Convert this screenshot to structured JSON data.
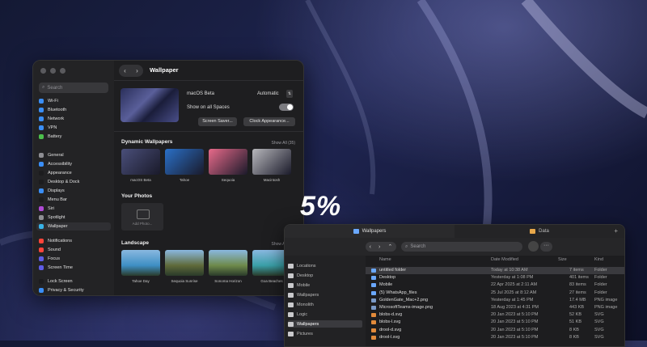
{
  "settings": {
    "search_placeholder": "Search",
    "window_title": "Wallpaper",
    "sidebar": [
      {
        "label": "Wi-Fi",
        "color": "#3a8ef6"
      },
      {
        "label": "Bluetooth",
        "color": "#3a8ef6"
      },
      {
        "label": "Network",
        "color": "#3a8ef6"
      },
      {
        "label": "VPN",
        "color": "#3a8ef6"
      },
      {
        "label": "Battery",
        "color": "#4cc04c"
      },
      {
        "label": "General",
        "color": "#8e8e93"
      },
      {
        "label": "Accessibility",
        "color": "#3a8ef6"
      },
      {
        "label": "Appearance",
        "color": "#1c1c1e"
      },
      {
        "label": "Desktop & Dock",
        "color": "#1c1c1e"
      },
      {
        "label": "Displays",
        "color": "#3a8ef6"
      },
      {
        "label": "Menu Bar",
        "color": "#1c1c1e"
      },
      {
        "label": "Siri",
        "color": "#b04ad6"
      },
      {
        "label": "Spotlight",
        "color": "#8e8e93"
      },
      {
        "label": "Wallpaper",
        "color": "#39b3e8"
      },
      {
        "label": "Notifications",
        "color": "#ff453a"
      },
      {
        "label": "Sound",
        "color": "#ff453a"
      },
      {
        "label": "Focus",
        "color": "#5e5ce6"
      },
      {
        "label": "Screen Time",
        "color": "#5e5ce6"
      },
      {
        "label": "Lock Screen",
        "color": "#1c1c1e"
      },
      {
        "label": "Privacy & Security",
        "color": "#3a8ef6"
      }
    ],
    "current_wallpaper": "macOS Beta",
    "mode": "Automatic",
    "show_all_spaces": "Show on all Spaces",
    "screen_saver_button": "Screen Saver...",
    "clock_button": "Clock Appearance...",
    "dynamic_title": "Dynamic Wallpapers",
    "dynamic_show_all": "Show All (35)",
    "dynamic": [
      {
        "label": "macOS Beta",
        "color": "#4a4f7a"
      },
      {
        "label": "Tahoe",
        "color": "#2a70c8"
      },
      {
        "label": "Sequoia",
        "color": "#e86a8a"
      },
      {
        "label": "Macintosh",
        "color": "#b8b8bc"
      }
    ],
    "photos_title": "Your Photos",
    "add_photo": "Add Photo...",
    "landscape_title": "Landscape",
    "landscape_show_all": "Show All (79)",
    "landscape": [
      {
        "label": "Tahoe Day",
        "color": "#3e8fc4"
      },
      {
        "label": "Sequoia Sunrise",
        "color": "#5f6a3a"
      },
      {
        "label": "Sonoma Horizon",
        "color": "#6e8a4a"
      },
      {
        "label": "Goa Beaches",
        "color": "#3aa0a8"
      }
    ]
  },
  "big_text": "5%",
  "finder": {
    "tab_active": "Wallpapers",
    "tab_inactive": "Data",
    "search_placeholder": "Search",
    "columns": {
      "name": "Name",
      "date": "Date Modified",
      "size": "Size",
      "kind": "Kind"
    },
    "sidebar": [
      "Locations",
      "Desktop",
      "Mobile",
      "Wallpapers",
      "Monolith",
      "Logic",
      "Wallpapers",
      "Pictures"
    ],
    "rows": [
      {
        "name": "untitled folder",
        "date": "Today at 10:38 AM",
        "size": "7 items",
        "kind": "Folder",
        "color": "#6aa8ff"
      },
      {
        "name": "Desktop",
        "date": "Yesterday at 1:08 PM",
        "size": "401 items",
        "kind": "Folder",
        "color": "#6aa8ff"
      },
      {
        "name": "Mobile",
        "date": "22 Apr 2025 at 2:11 AM",
        "size": "83 items",
        "kind": "Folder",
        "color": "#6aa8ff"
      },
      {
        "name": "(5) WhatsApp_files",
        "date": "25 Jul 2025 at 8:12 AM",
        "size": "27 items",
        "kind": "Folder",
        "color": "#6aa8ff"
      },
      {
        "name": "GoldenGate_Mac+2.png",
        "date": "Yesterday at 1:45 PM",
        "size": "17.4 MB",
        "kind": "PNG image",
        "color": "#7a9ac8"
      },
      {
        "name": "MicrosoftTeams-image.png",
        "date": "18 Aug 2023 at 4:31 PM",
        "size": "443 KB",
        "kind": "PNG image",
        "color": "#7a9ac8"
      },
      {
        "name": "blobs-d.svg",
        "date": "20 Jan 2023 at 5:10 PM",
        "size": "52 KB",
        "kind": "SVG",
        "color": "#e28a3a"
      },
      {
        "name": "blobs-l.svg",
        "date": "20 Jan 2023 at 5:10 PM",
        "size": "51 KB",
        "kind": "SVG",
        "color": "#e28a3a"
      },
      {
        "name": "drool-d.svg",
        "date": "20 Jan 2023 at 5:10 PM",
        "size": "8 KB",
        "kind": "SVG",
        "color": "#e28a3a"
      },
      {
        "name": "drool-l.svg",
        "date": "20 Jan 2023 at 5:10 PM",
        "size": "8 KB",
        "kind": "SVG",
        "color": "#e28a3a"
      }
    ]
  }
}
